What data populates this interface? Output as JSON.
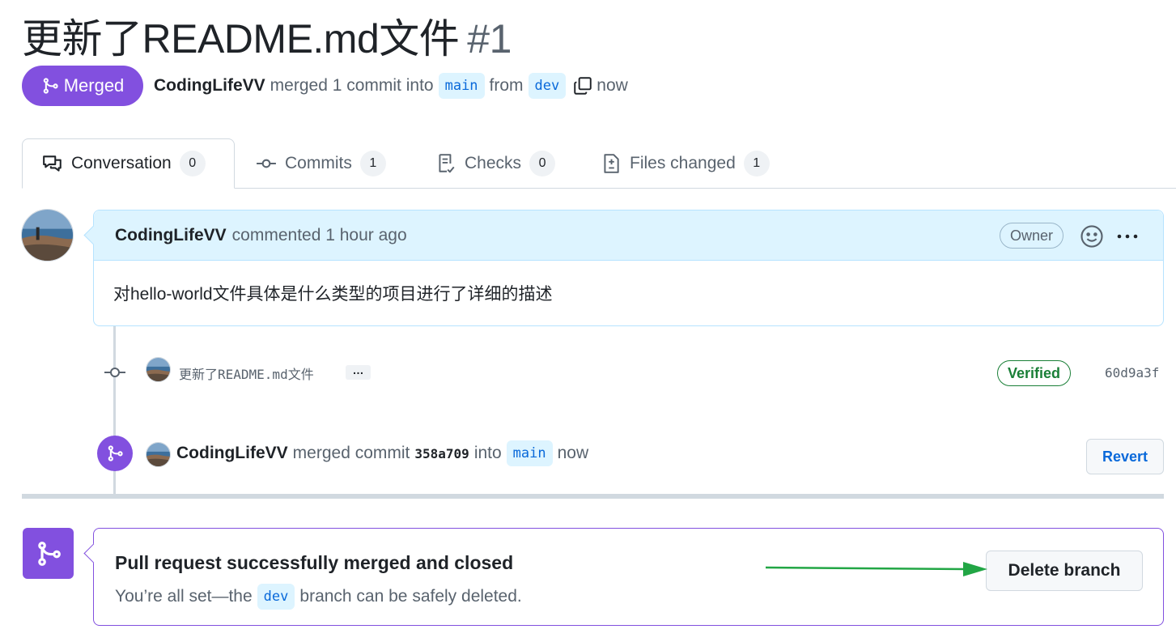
{
  "pr": {
    "title": "更新了README.md文件",
    "number": "#1",
    "state_label": "Merged",
    "author": "CodingLifeVV",
    "merged_text": "merged 1 commit into",
    "base_branch": "main",
    "from_text": "from",
    "head_branch": "dev",
    "time": "now"
  },
  "tabs": [
    {
      "label": "Conversation",
      "count": "0",
      "icon": "comment-discussion-icon"
    },
    {
      "label": "Commits",
      "count": "1",
      "icon": "git-commit-icon"
    },
    {
      "label": "Checks",
      "count": "0",
      "icon": "checklist-icon"
    },
    {
      "label": "Files changed",
      "count": "1",
      "icon": "file-diff-icon"
    }
  ],
  "comment": {
    "author": "CodingLifeVV",
    "meta": "commented 1 hour ago",
    "role_badge": "Owner",
    "body": "对hello-world文件具体是什么类型的项目进行了详细的描述"
  },
  "commit": {
    "message": "更新了README.md文件",
    "ellipsis": "…",
    "verified_label": "Verified",
    "sha": "60d9a3f"
  },
  "merge_event": {
    "author": "CodingLifeVV",
    "text1": "merged commit",
    "sha": "358a709",
    "text2": "into",
    "branch": "main",
    "time": "now",
    "revert_label": "Revert"
  },
  "merged_box": {
    "title": "Pull request successfully merged and closed",
    "sub_prefix": "You’re all set—the",
    "branch": "dev",
    "sub_suffix": "branch can be safely deleted.",
    "delete_label": "Delete branch"
  },
  "colors": {
    "merged_purple": "#8250df",
    "link_blue": "#0969da",
    "verified_green": "#1a7f37",
    "annotation_arrow": "#22a645"
  }
}
